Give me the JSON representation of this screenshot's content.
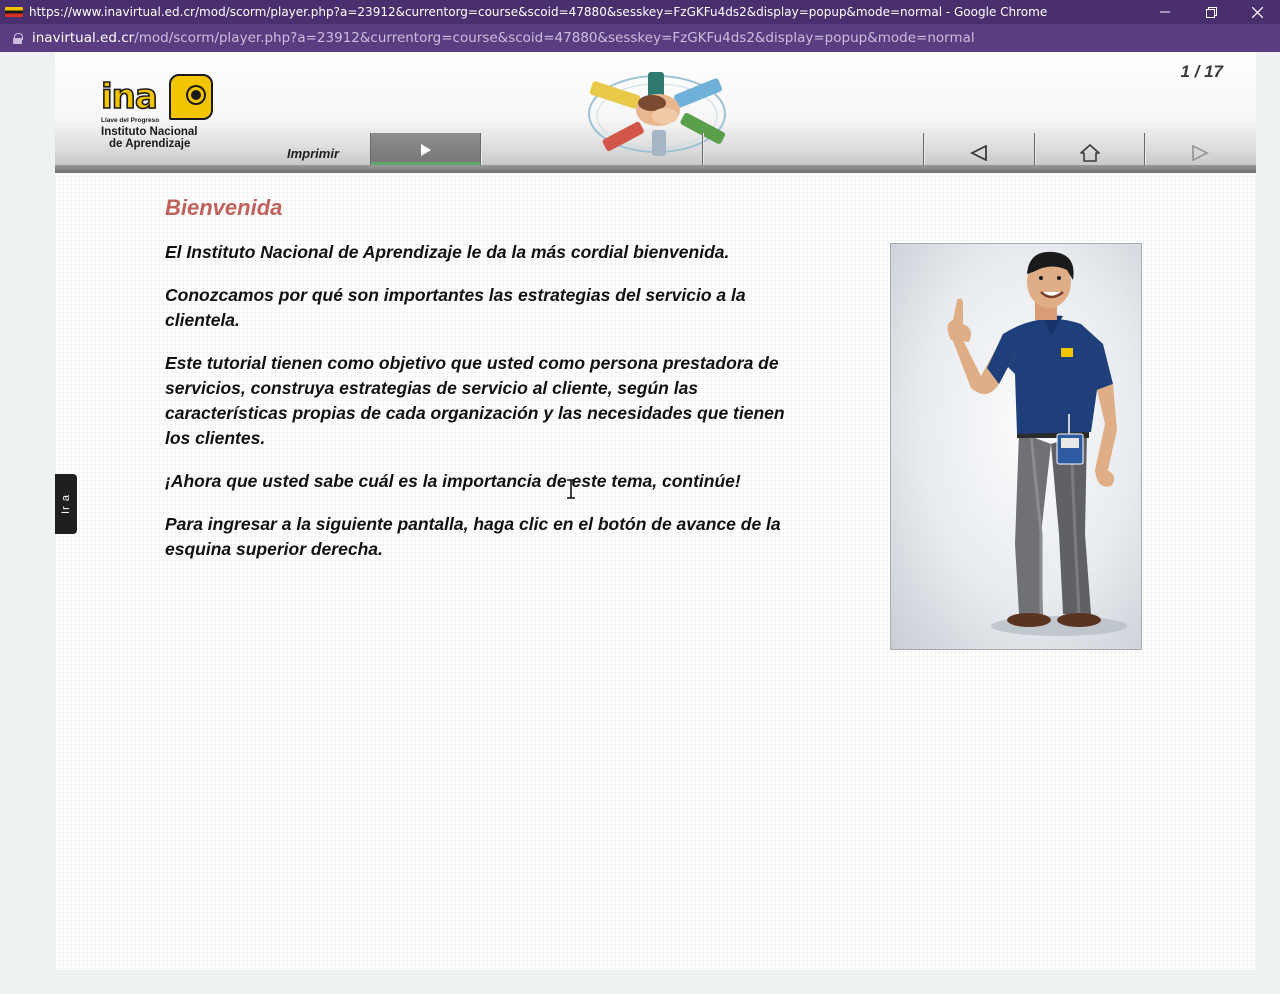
{
  "window": {
    "title": "https://www.inavirtual.ed.cr/mod/scorm/player.php?a=23912&currentorg=course&scoid=47880&sesskey=FzGKFu4ds2&display=popup&mode=normal - Google Chrome",
    "favicon": "ina-flag-icon"
  },
  "address": {
    "host": "inavirtual.ed.cr",
    "path": "/mod/scorm/player.php?a=23912&currentorg=course&scoid=47880&sesskey=FzGKFu4ds2&display=popup&mode=normal"
  },
  "header": {
    "logo": {
      "word": "ina",
      "tagline": "Llave del Progreso",
      "name_line1": "Instituto Nacional",
      "name_line2": "de Aprendizaje"
    },
    "page_counter": "1 / 17",
    "print_label": "Imprimir",
    "nav_icons": [
      "play-icon",
      "back-arrow-icon",
      "home-icon",
      "forward-arrow-icon"
    ]
  },
  "side_tab": {
    "label": "Ir a"
  },
  "main": {
    "title": "Bienvenida",
    "paragraphs": [
      "El Instituto Nacional de Aprendizaje le da la más cordial bienvenida.",
      "Conozcamos por qué son importantes las estrategias del servicio a la clientela.",
      "Este tutorial tienen como objetivo que usted como persona prestadora de servicios, construya estrategias de servicio al cliente, según las características propias de cada organización y las necesidades que tienen los clientes.",
      "¡Ahora que usted sabe cuál es la importancia de este tema, continúe!",
      "Para ingresar a la siguiente pantalla, haga clic en el botón de avance de la esquina superior derecha."
    ]
  },
  "colors": {
    "title_bar": "#4a2f6e",
    "address_bar": "#5a3d80",
    "heading": "#c0615c",
    "brand_yellow": "#f2c500",
    "shirt": "#1e3f7a"
  }
}
